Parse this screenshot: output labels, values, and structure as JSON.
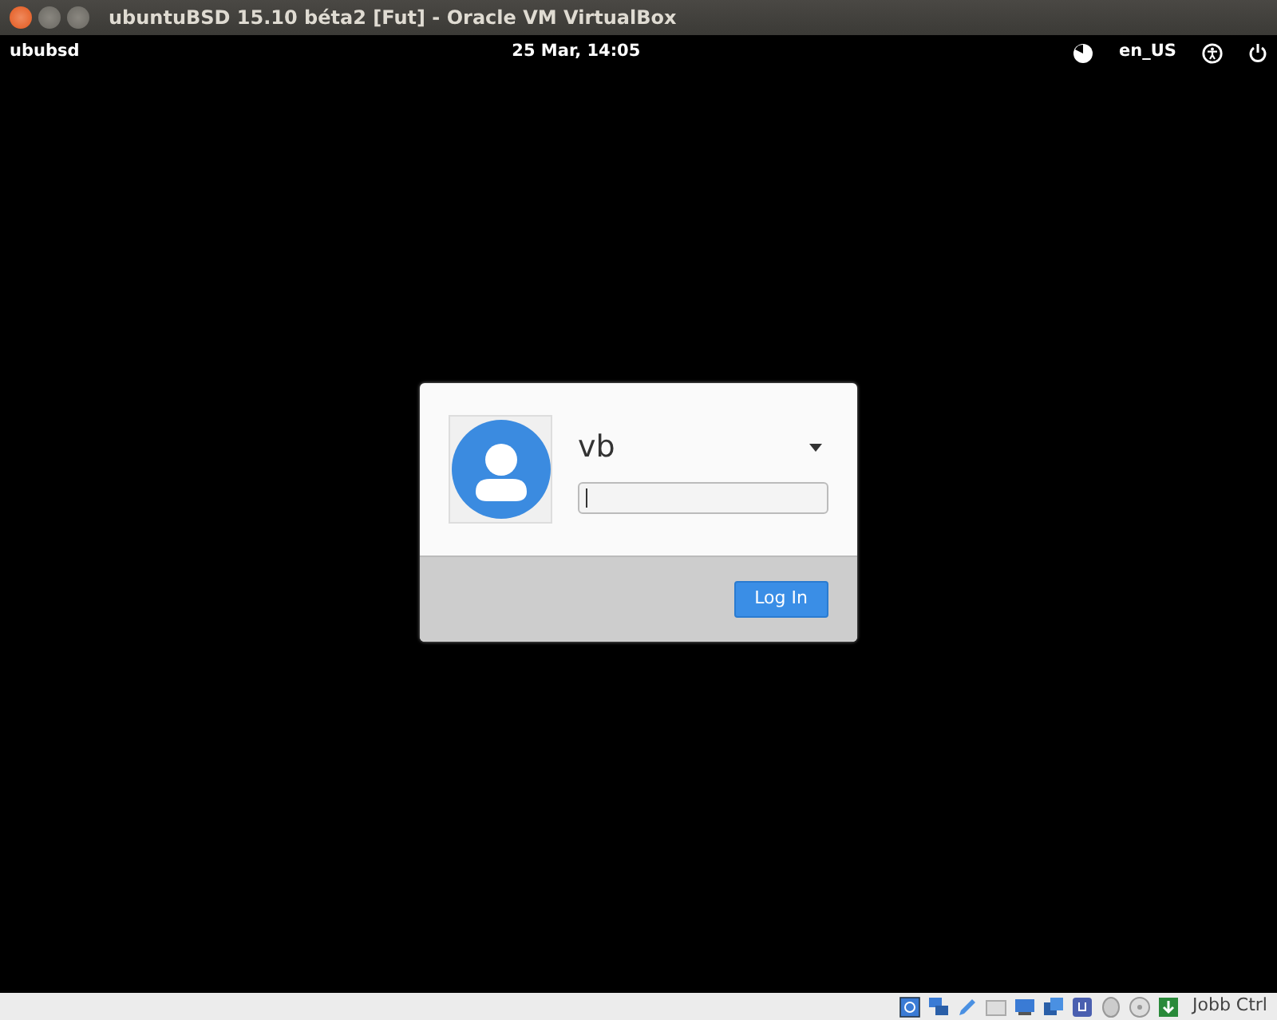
{
  "window": {
    "title": "ubuntuBSD 15.10 béta2 [Fut] - Oracle VM VirtualBox"
  },
  "top_panel": {
    "hostname": "ububsd",
    "datetime": "25 Mar, 14:05",
    "keyboard_layout": "en_US"
  },
  "login": {
    "username": "vb",
    "button": "Log In"
  },
  "status_bar": {
    "host_key": "Jobb Ctrl"
  }
}
